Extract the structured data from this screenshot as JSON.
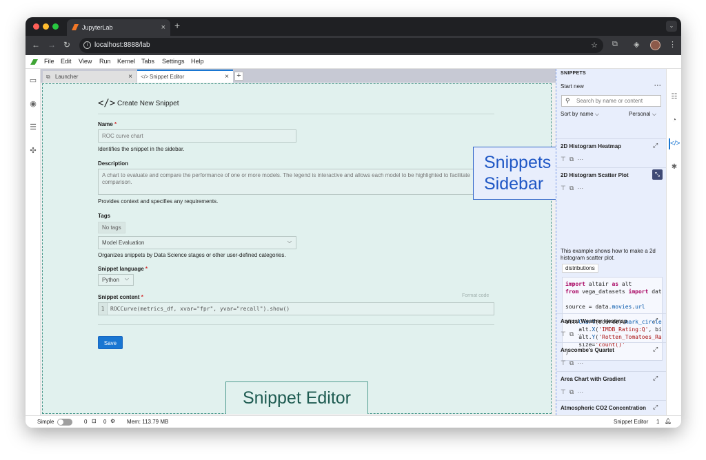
{
  "browser": {
    "tab_title": "JupyterLab",
    "tab_close": "×",
    "new_tab": "+",
    "url": "localhost:8888/lab"
  },
  "menu": [
    "File",
    "Edit",
    "View",
    "Run",
    "Kernel",
    "Tabs",
    "Settings",
    "Help"
  ],
  "doc_tabs": [
    {
      "label": "Launcher"
    },
    {
      "label": "Snippet Editor"
    }
  ],
  "editor": {
    "header": "Create New Snippet",
    "name_label": "Name",
    "name_value": "ROC curve chart",
    "name_help": "Identifies the snippet in the sidebar.",
    "description_label": "Description",
    "description_value": "A chart to evaluate and compare the performance of one or more models. The legend is interactive and allows each model to be highlighted to facilitate comparison.",
    "description_help": "Provides context and specifies any requirements.",
    "tags_label": "Tags",
    "tags_value": "No tags",
    "category_value": "Model Evaluation",
    "category_help": "Organizes snippets by Data Science stages or other user-defined categories.",
    "language_label": "Snippet language",
    "language_value": "Python",
    "content_label": "Snippet content",
    "format_code": "Format code",
    "line_number": "1",
    "code": "ROCCurve(metrics_df, xvar=\"fpr\", yvar=\"recall\").show()",
    "save": "Save",
    "required_mark": "*"
  },
  "annotations": {
    "editor": "Snippet Editor",
    "sidebar_line1": "Snippets",
    "sidebar_line2": "Sidebar"
  },
  "sidebar": {
    "title": "SNIPPETS",
    "start_new": "Start new",
    "search_placeholder": "Search by name or content",
    "sort": "Sort by name",
    "filter": "Personal",
    "items": [
      {
        "name": "2D Histogram Heatmap"
      },
      {
        "name": "2D Histogram Scatter Plot"
      },
      {
        "name": "Annual Weather Heatmap"
      },
      {
        "name": "Anscombe's Quartet"
      },
      {
        "name": "Area Chart with Gradient"
      },
      {
        "name": "Atmospheric CO2 Concentration"
      }
    ],
    "expanded_description": "This example shows how to make a 2d histogram scatter plot.",
    "expanded_tag": "distributions",
    "code_lines": [
      "import altair as alt",
      "from vega_datasets import data",
      "",
      "source = data.movies.url",
      "",
      "alt.Chart(source).mark_circle(",
      "    alt.X('IMDB_Rating:Q', bin",
      "    alt.Y('Rotten_Tomatoes_Rati",
      "    size='count()'",
      ")"
    ]
  },
  "status": {
    "mode": "Simple",
    "terminals": "0",
    "kernels": "0",
    "memory": "Mem: 113.79 MB",
    "active": "Snippet Editor",
    "count": "1"
  },
  "icons": {
    "left": [
      "folder-icon",
      "stop-circle-icon",
      "list-icon",
      "puzzle-icon"
    ],
    "right": [
      "settings-sliders-icon",
      "gauge-icon",
      "code-icon",
      "bug-icon"
    ]
  }
}
